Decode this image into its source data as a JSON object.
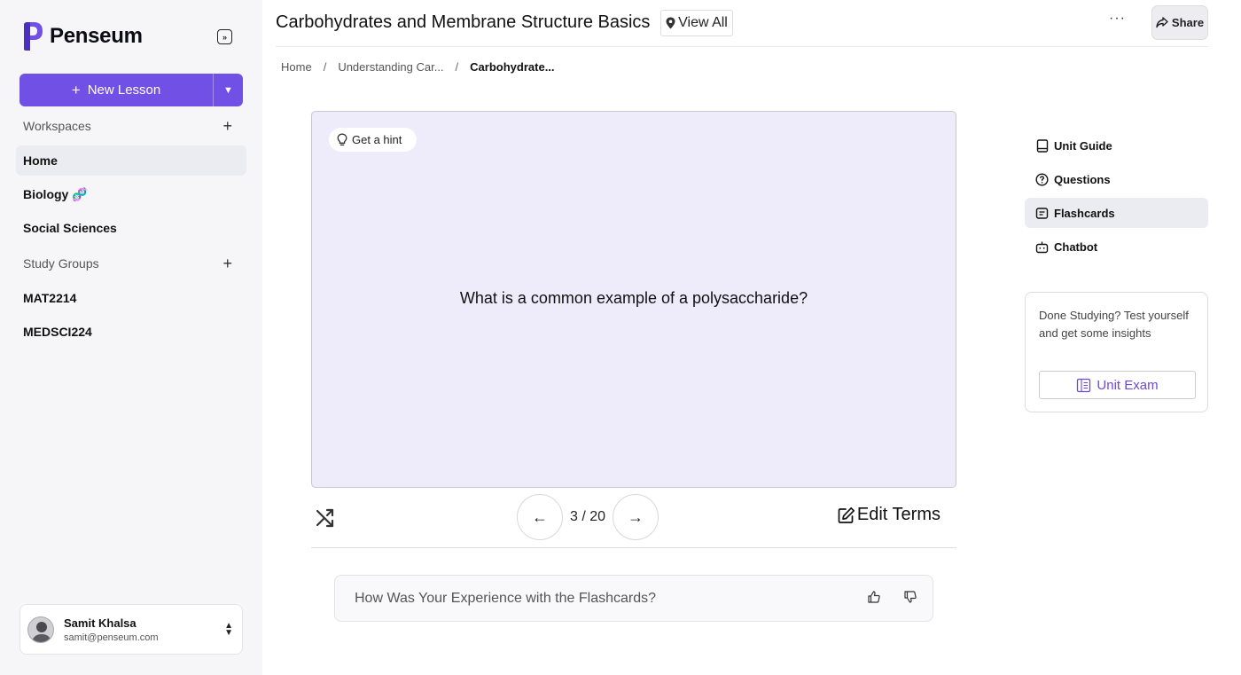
{
  "brand": {
    "name": "Penseum",
    "accent": "#7150e6"
  },
  "sidebar": {
    "new_lesson_label": "New Lesson",
    "workspaces_label": "Workspaces",
    "workspaces": [
      {
        "label": "Home",
        "active": true
      },
      {
        "label": "Biology 🧬",
        "active": false
      },
      {
        "label": "Social Sciences",
        "active": false
      }
    ],
    "study_groups_label": "Study Groups",
    "study_groups": [
      {
        "label": "MAT2214"
      },
      {
        "label": "MEDSCI224"
      }
    ],
    "user": {
      "name": "Samit Khalsa",
      "email": "samit@penseum.com"
    }
  },
  "header": {
    "title": "Carbohydrates and Membrane Structure Basics",
    "view_all_label": "View All",
    "more_label": "···",
    "share_label": "Share"
  },
  "breadcrumb": [
    "Home",
    "Understanding Car...",
    "Carbohydrate..."
  ],
  "flashcard": {
    "hint_label": "Get a hint",
    "question": "What is a common example of a polysaccharide?",
    "current": 3,
    "total": 20,
    "counter_text": "3 / 20",
    "edit_terms_label": "Edit Terms"
  },
  "feedback": {
    "prompt": "How Was Your Experience with the Flashcards?"
  },
  "right_nav": [
    {
      "label": "Unit Guide",
      "icon": "book-icon",
      "active": false
    },
    {
      "label": "Questions",
      "icon": "question-circle-icon",
      "active": false
    },
    {
      "label": "Flashcards",
      "icon": "flashcards-icon",
      "active": true
    },
    {
      "label": "Chatbot",
      "icon": "bot-icon",
      "active": false
    }
  ],
  "exam_card": {
    "text": "Done Studying? Test yourself and get some insights",
    "button_label": "Unit Exam"
  }
}
